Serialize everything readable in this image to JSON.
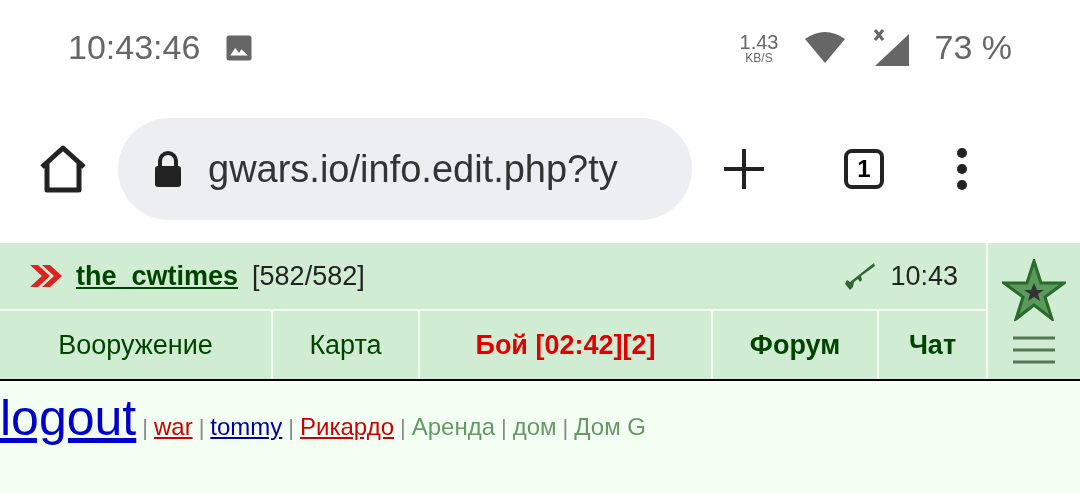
{
  "status_bar": {
    "time": "10:43:46",
    "speed": "1.43",
    "speed_unit": "KB/S",
    "battery": "73 %"
  },
  "browser": {
    "url": "gwars.io/info.edit.php?ty",
    "tab_count": "1"
  },
  "header": {
    "player": "the_cwtimes",
    "hp": "[582/582]",
    "clock": "10:43"
  },
  "nav": [
    {
      "label": "Вооружение",
      "kind": "plain"
    },
    {
      "label": "Карта",
      "kind": "plain"
    },
    {
      "label": "Бой [02:42][2]",
      "kind": "alert"
    },
    {
      "label": "Форум",
      "kind": "bold"
    },
    {
      "label": "Чат",
      "kind": "bold"
    }
  ],
  "links": [
    {
      "label": "logout",
      "kind": "big",
      "color": "#0000cc"
    },
    {
      "separator": "|",
      "label": "war",
      "kind": "link",
      "color": "#cc0000"
    },
    {
      "separator": "|",
      "label": "tommy",
      "kind": "link",
      "color": "#000099"
    },
    {
      "separator": "|",
      "label": "Рикардо",
      "kind": "link",
      "color": "#cc0000"
    },
    {
      "separator": "|",
      "label": "Аренда",
      "kind": "text",
      "color": "#669966"
    },
    {
      "separator": "|",
      "label": "дом",
      "kind": "text",
      "color": "#669966"
    },
    {
      "separator": "|",
      "label": "Дом G",
      "kind": "text",
      "color": "#669966"
    }
  ]
}
